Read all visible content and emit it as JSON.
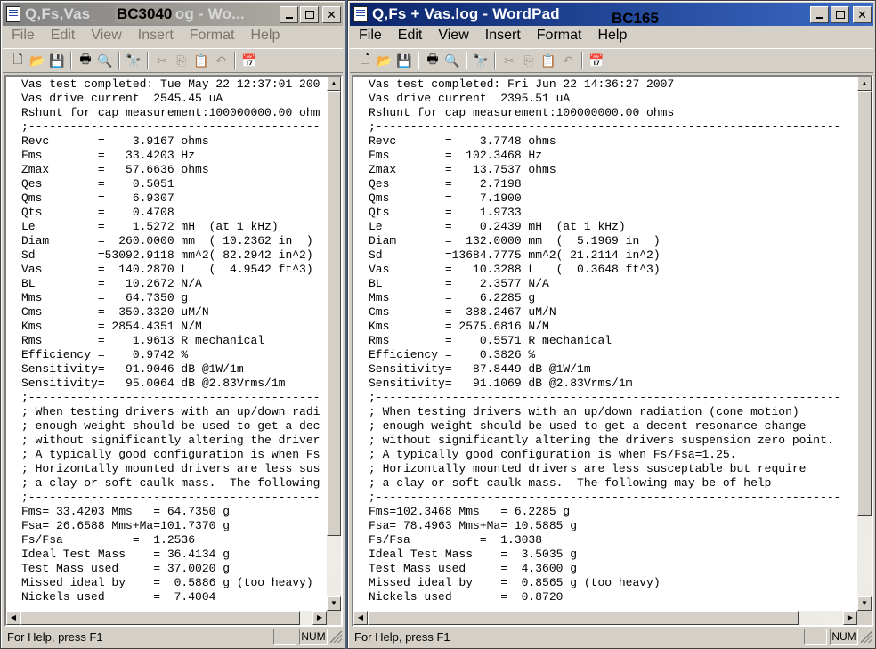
{
  "window_left": {
    "title": "Q,Fs,Vas_",
    "title_tail": "t.log - Wo...",
    "title_annotation": "BC3040",
    "menus": [
      "File",
      "Edit",
      "View",
      "Insert",
      "Format",
      "Help"
    ],
    "lines": [
      "Vas test completed: Tue May 22 12:37:01 200",
      "Vas drive current  2545.45 uA",
      "Rshunt for cap measurement:100000000.00 ohm",
      ";------------------------------------------",
      "Revc       =    3.9167 ohms",
      "Fms        =   33.4203 Hz",
      "Zmax       =   57.6636 ohms",
      "Qes        =    0.5051",
      "Qms        =    6.9307",
      "Qts        =    0.4708",
      "Le         =    1.5272 mH  (at 1 kHz)",
      "Diam       =  260.0000 mm  ( 10.2362 in  )",
      "Sd         =53092.9118 mm^2( 82.2942 in^2)",
      "Vas        =  140.2870 L   (  4.9542 ft^3)",
      "BL         =   10.2672 N/A",
      "Mms        =   64.7350 g",
      "Cms        =  350.3320 uM/N",
      "Kms        = 2854.4351 N/M",
      "Rms        =    1.9613 R mechanical",
      "Efficiency =    0.9742 %",
      "Sensitivity=   91.9046 dB @1W/1m",
      "Sensitivity=   95.0064 dB @2.83Vrms/1m",
      ";------------------------------------------",
      "; When testing drivers with an up/down radi",
      "; enough weight should be used to get a dec",
      "; without significantly altering the driver",
      "; A typically good configuration is when Fs",
      "; Horizontally mounted drivers are less sus",
      "; a clay or soft caulk mass.  The following",
      ";------------------------------------------",
      "Fms= 33.4203 Mms   = 64.7350 g",
      "Fsa= 26.6588 Mms+Ma=101.7370 g",
      "Fs/Fsa          =  1.2536",
      "Ideal Test Mass    = 36.4134 g",
      "Test Mass used     = 37.0020 g",
      "Missed ideal by    =  0.5886 g (too heavy)",
      "Nickels used       =  7.4004"
    ],
    "status_text": "For Help, press F1",
    "status_num": "NUM"
  },
  "window_right": {
    "title": "Q,Fs + Vas.log - WordPad",
    "title_annotation": "BC165",
    "menus": [
      "File",
      "Edit",
      "View",
      "Insert",
      "Format",
      "Help"
    ],
    "lines": [
      "Vas test completed: Fri Jun 22 14:36:27 2007",
      "Vas drive current  2395.51 uA",
      "Rshunt for cap measurement:100000000.00 ohms",
      ";-------------------------------------------------------------------",
      "Revc       =    3.7748 ohms",
      "Fms        =  102.3468 Hz",
      "Zmax       =   13.7537 ohms",
      "Qes        =    2.7198",
      "Qms        =    7.1900",
      "Qts        =    1.9733",
      "Le         =    0.2439 mH  (at 1 kHz)",
      "Diam       =  132.0000 mm  (  5.1969 in  )",
      "Sd         =13684.7775 mm^2( 21.2114 in^2)",
      "Vas        =   10.3288 L   (  0.3648 ft^3)",
      "BL         =    2.3577 N/A",
      "Mms        =    6.2285 g",
      "Cms        =  388.2467 uM/N",
      "Kms        = 2575.6816 N/M",
      "Rms        =    0.5571 R mechanical",
      "Efficiency =    0.3826 %",
      "Sensitivity=   87.8449 dB @1W/1m",
      "Sensitivity=   91.1069 dB @2.83Vrms/1m",
      ";-------------------------------------------------------------------",
      "; When testing drivers with an up/down radiation (cone motion)",
      "; enough weight should be used to get a decent resonance change",
      "; without significantly altering the drivers suspension zero point.",
      "; A typically good configuration is when Fs/Fsa=1.25.",
      "; Horizontally mounted drivers are less susceptable but require",
      "; a clay or soft caulk mass.  The following may be of help",
      ";-------------------------------------------------------------------",
      "Fms=102.3468 Mms   = 6.2285 g",
      "Fsa= 78.4963 Mms+Ma= 10.5885 g",
      "Fs/Fsa          =  1.3038",
      "Ideal Test Mass    =  3.5035 g",
      "Test Mass used     =  4.3600 g",
      "Missed ideal by    =  0.8565 g (too heavy)",
      "Nickels used       =  0.8720"
    ],
    "status_text": "For Help, press F1",
    "status_num": "NUM"
  }
}
